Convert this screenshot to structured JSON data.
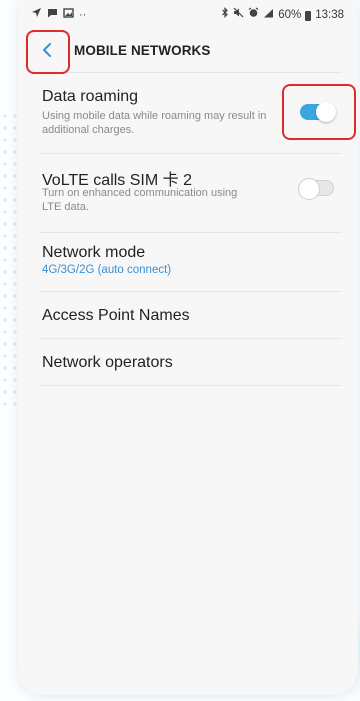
{
  "status_bar": {
    "dots": "··",
    "battery_percent": "60%",
    "time": "13:38",
    "icons": [
      "navigation-arrow-icon",
      "message-icon",
      "image-icon",
      "bluetooth-icon",
      "mute-icon",
      "alarm-icon",
      "signal-icon",
      "battery-icon"
    ]
  },
  "header": {
    "back_icon": "chevron-left-icon",
    "title": "MOBILE NETWORKS"
  },
  "settings": [
    {
      "title": "Data roaming",
      "subtitle": "Using mobile data while roaming may result in additional charges.",
      "toggle": true
    },
    {
      "title": "VoLTE calls SIM 卡 2",
      "subtitle": "Turn on enhanced communication using LTE data.",
      "toggle": false
    },
    {
      "title": "Network mode",
      "subtitle": "4G/3G/2G (auto connect)"
    },
    {
      "title": "Access Point Names"
    },
    {
      "title": "Network operators"
    }
  ],
  "colors": {
    "accent": "#38a7e0",
    "highlight": "#e02b2b",
    "link": "#3b8fd4"
  }
}
